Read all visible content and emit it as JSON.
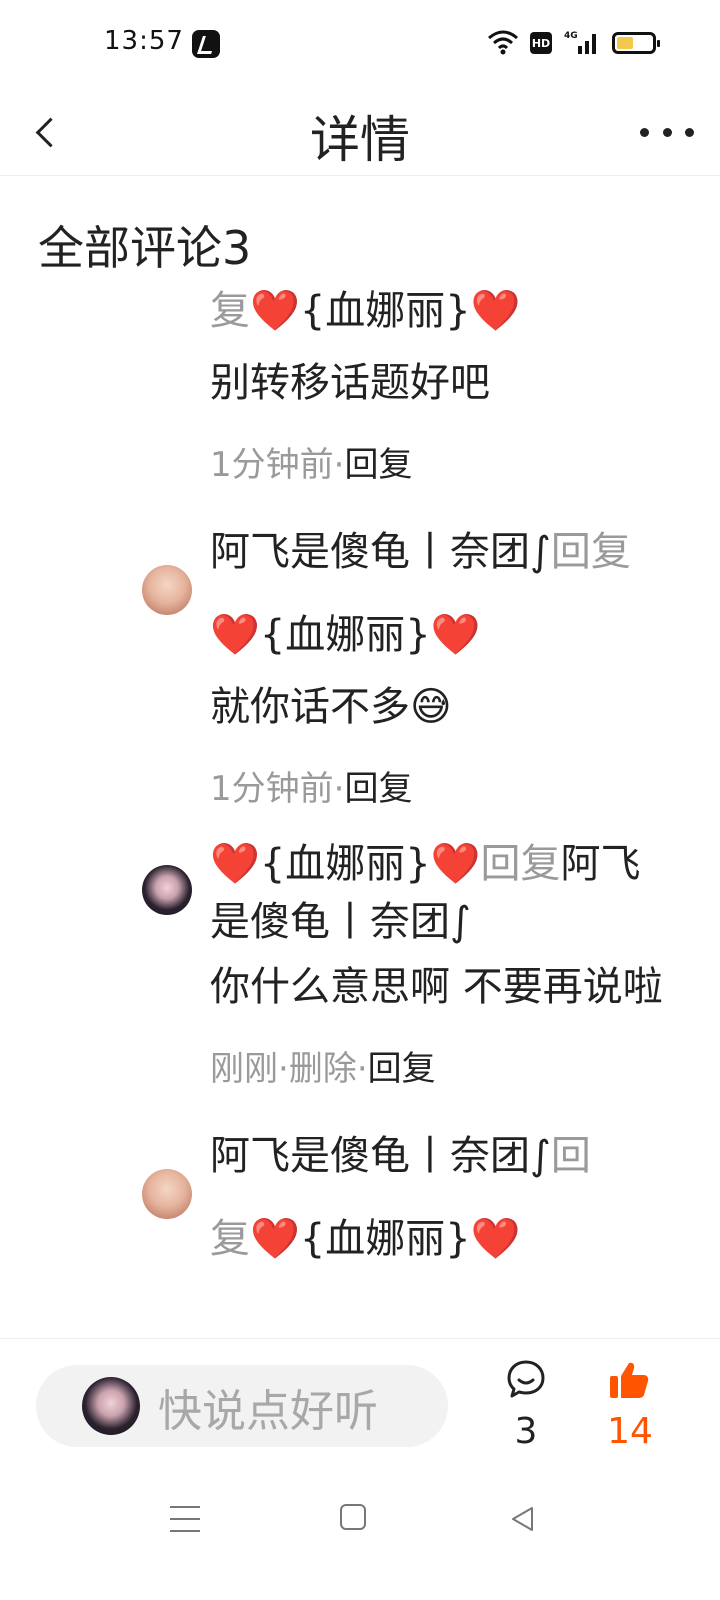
{
  "status_bar": {
    "time": "13:57",
    "hd_label": "HD",
    "network_label": "4G"
  },
  "header": {
    "title": "详情"
  },
  "comments_section": {
    "title": "全部评论3"
  },
  "comments": [
    {
      "line1_reply": "复",
      "line1_heart_left": "❤️",
      "line1_name": "{血娜丽}",
      "line1_heart_right": "❤️",
      "body": "别转移话题好吧",
      "time": "1分钟前",
      "separator": "·",
      "reply_label": "回复"
    },
    {
      "user": "阿飞是傻龟丨奈团∫",
      "reply_word": "回复",
      "target_heart_left": "❤️",
      "target_name": "{血娜丽}",
      "target_heart_right": "❤️",
      "body": "就你话不多😅",
      "time": "1分钟前",
      "separator": "·",
      "reply_label": "回复"
    },
    {
      "user_heart_left": "❤️",
      "user_name": "{血娜丽}",
      "user_heart_right": "❤️",
      "reply_word": "回复",
      "target_start": "阿",
      "target_rest": "飞是傻龟丨奈团∫",
      "body": "你什么意思啊 不要再说啦",
      "time": "刚刚",
      "separator": "·",
      "delete_label": "删除",
      "reply_label": "回复"
    },
    {
      "user": "阿飞是傻龟丨奈团∫",
      "reply_word_start": "回",
      "reply_word_end": "复",
      "target_heart_left": "❤️",
      "target_name": "{血娜丽}",
      "target_heart_right": "❤️"
    }
  ],
  "bottom_bar": {
    "input_placeholder": "快说点好听",
    "comment_count": "3",
    "like_count": "14",
    "like_color": "#ff5500"
  },
  "icons": {
    "back": "chevron-left-icon",
    "more": "more-dots-icon",
    "comment": "chat-bubble-icon",
    "like": "thumbs-up-icon"
  }
}
